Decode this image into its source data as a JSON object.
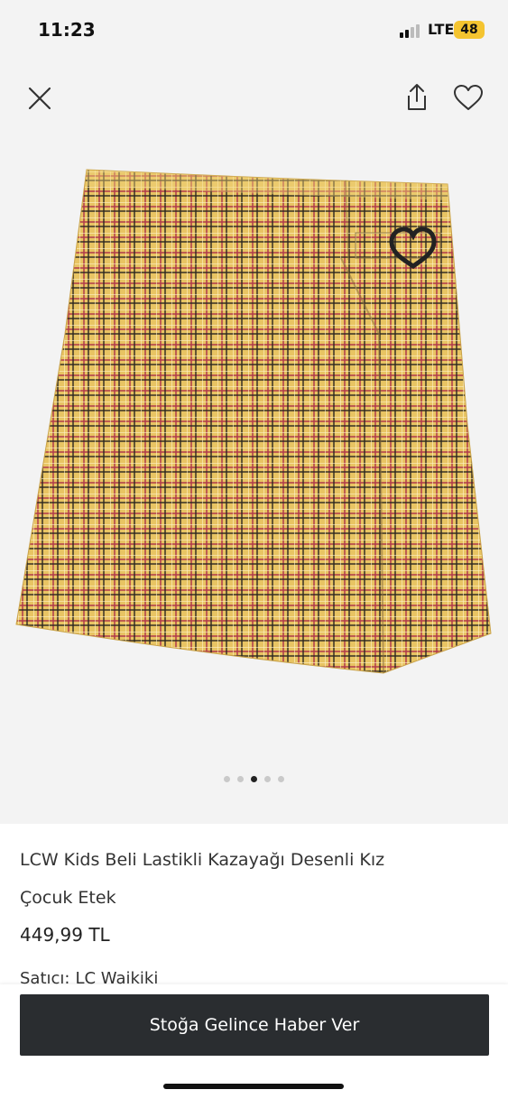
{
  "status_bar": {
    "time": "11:23",
    "network": "LTE",
    "battery": "48"
  },
  "header": {
    "close_icon": "close-icon",
    "share_icon": "share-icon",
    "favorite_icon": "heart-icon"
  },
  "gallery": {
    "image": "plaid-skirt-photo",
    "page_count": 5,
    "active_index": 2,
    "colors": {
      "fabric": "#e8c463",
      "red_line": "#b0394a",
      "dark_line": "#2b2620"
    }
  },
  "product": {
    "title": "LCW Kids Beli Lastikli Kazayağı Desenli Kız Çocuk Etek",
    "price": "449,99 TL",
    "seller_label": "Satıcı:",
    "seller_name": "LC Waikiki"
  },
  "footer": {
    "cta_label": "Stoğa Gelince Haber Ver"
  }
}
